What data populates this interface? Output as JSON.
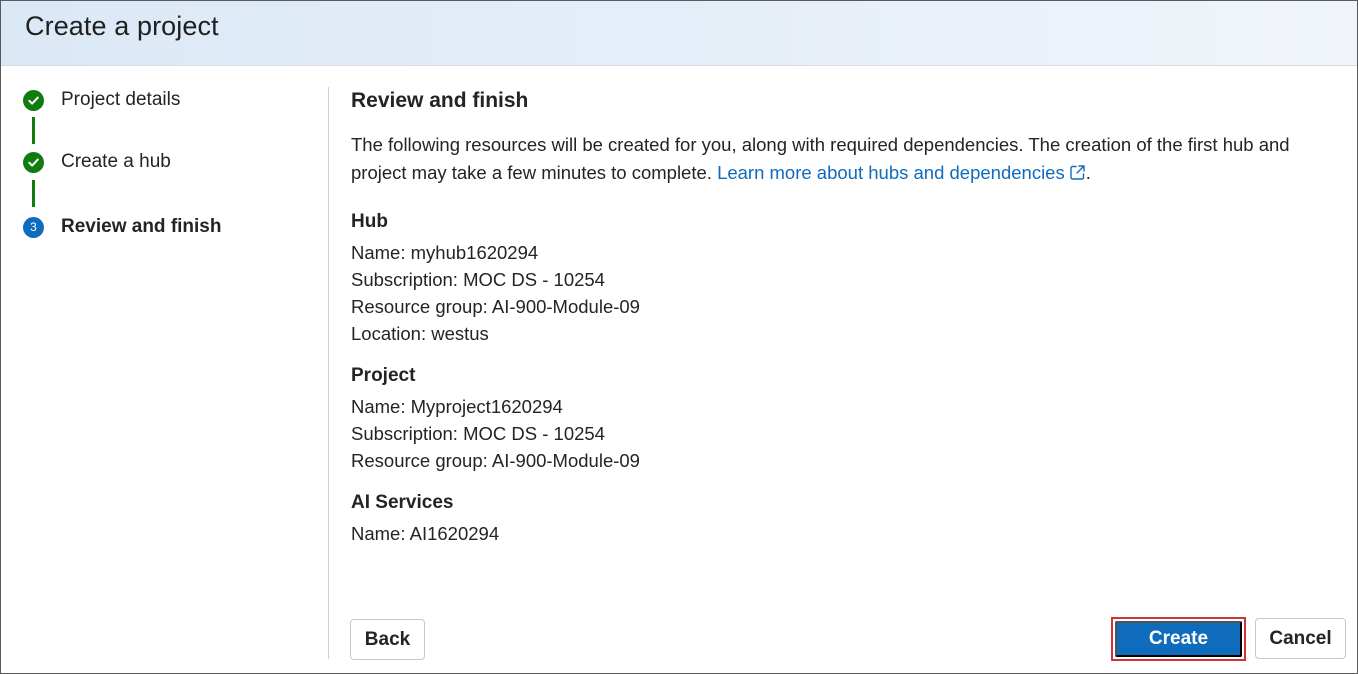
{
  "dialog": {
    "title": "Create a project"
  },
  "stepper": {
    "steps": [
      {
        "label": "Project details",
        "status": "completed"
      },
      {
        "label": "Create a hub",
        "status": "completed"
      },
      {
        "label": "Review and finish",
        "status": "current",
        "number": "3"
      }
    ]
  },
  "main": {
    "title": "Review and finish",
    "intro": "The following resources will be created for you, along with required dependencies. The creation of the first hub and project may take a few minutes to complete.",
    "learn_more_link": "Learn more about hubs and dependencies",
    "intro_end": ".",
    "groups": [
      {
        "title": "Hub",
        "lines": [
          "Name: myhub1620294",
          "Subscription: MOC DS - 10254",
          "Resource group: AI-900-Module-09",
          "Location: westus"
        ]
      },
      {
        "title": "Project",
        "lines": [
          "Name: Myproject1620294",
          "Subscription: MOC DS - 10254",
          "Resource group: AI-900-Module-09"
        ]
      },
      {
        "title": "AI Services",
        "lines": [
          "Name: AI1620294"
        ]
      }
    ]
  },
  "footer": {
    "back_label": "Back",
    "create_label": "Create",
    "cancel_label": "Cancel"
  },
  "colors": {
    "accent": "#0f6cbd",
    "success": "#107c10",
    "highlight": "#d13438"
  }
}
